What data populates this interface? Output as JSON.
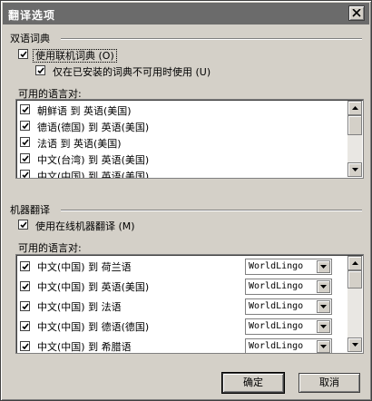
{
  "window": {
    "title": "翻译选项"
  },
  "dictionary": {
    "group_label": "双语词典",
    "use_online_label": "使用联机词典",
    "use_online_key": "(O)",
    "use_online_checked": true,
    "fallback_label": "仅在已安装的词典不可用时使用",
    "fallback_key": "(U)",
    "fallback_checked": true,
    "pairs_label": "可用的语言对:",
    "pairs": [
      {
        "label": "朝鲜语 到 英语(美国)",
        "checked": true
      },
      {
        "label": "德语(德国) 到 英语(美国)",
        "checked": true
      },
      {
        "label": "法语 到 英语(美国)",
        "checked": true
      },
      {
        "label": "中文(台湾) 到 英语(美国)",
        "checked": true
      },
      {
        "label": "中文(中国) 到 英语(美国)",
        "checked": true
      }
    ]
  },
  "machine": {
    "group_label": "机器翻译",
    "use_online_label": "使用在线机器翻译",
    "use_online_key": "(M)",
    "use_online_checked": true,
    "pairs_label": "可用的语言对:",
    "pairs": [
      {
        "label": "中文(中国) 到 荷兰语",
        "checked": true,
        "provider": "WorldLingo"
      },
      {
        "label": "中文(中国) 到 英语(美国)",
        "checked": true,
        "provider": "WorldLingo"
      },
      {
        "label": "中文(中国) 到 法语",
        "checked": true,
        "provider": "WorldLingo"
      },
      {
        "label": "中文(中国) 到 德语(德国)",
        "checked": true,
        "provider": "WorldLingo"
      },
      {
        "label": "中文(中国) 到 希腊语",
        "checked": true,
        "provider": "WorldLingo"
      }
    ]
  },
  "buttons": {
    "ok": "确定",
    "cancel": "取消"
  },
  "colors": {
    "face": "#d4d0c8",
    "titlebar": "#6b6b6b",
    "shadow": "#808080"
  },
  "icons": {
    "close": "close-icon",
    "check": "checkmark-icon",
    "scroll_up": "arrow-up-icon",
    "scroll_down": "arrow-down-icon",
    "dropdown": "chevron-down-icon"
  }
}
